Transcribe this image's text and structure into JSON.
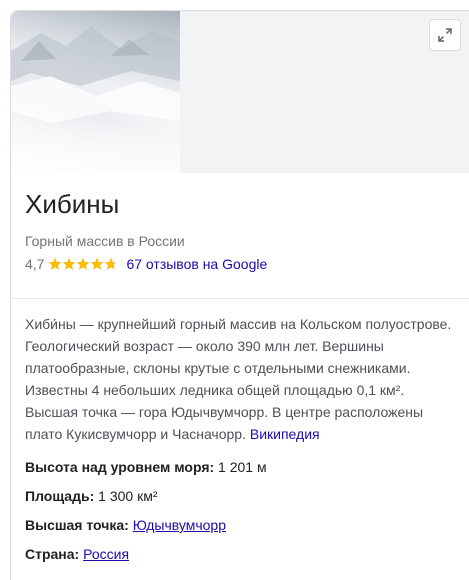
{
  "entity": {
    "title": "Хибины",
    "subtitle": "Горный массив в России",
    "rating": "4,7",
    "stars": 4.7,
    "reviews_link": "67 отзывов на Google",
    "star_color": "#fbbc04"
  },
  "hero": {
    "expand_icon": "expand-icon"
  },
  "description": {
    "text": "Хиби́ны — крупнейший горный массив на Кольском полуострове. Геологический возраст — около 390 млн лет. Вершины платообразные, склоны крутые с отдельными снежниками. Известны 4 небольших ледника общей площадью 0,1 км². Высшая точка — гора Юдычвумчорр. В центре расположены плато Кукисвумчорр и Часначорр.",
    "source_link": "Википедия"
  },
  "facts": {
    "altitude": {
      "label": "Высота над уровнем моря:",
      "value": "1 201 м"
    },
    "area": {
      "label": "Площадь:",
      "value": "1 300 км²"
    },
    "highest_point": {
      "label": "Высшая точка:",
      "value": "Юдычвумчорр"
    },
    "country": {
      "label": "Страна:",
      "value": "Россия"
    }
  },
  "colors": {
    "link": "#1a0dab",
    "muted": "#70757a",
    "text": "#202124",
    "border": "#dadce0"
  }
}
